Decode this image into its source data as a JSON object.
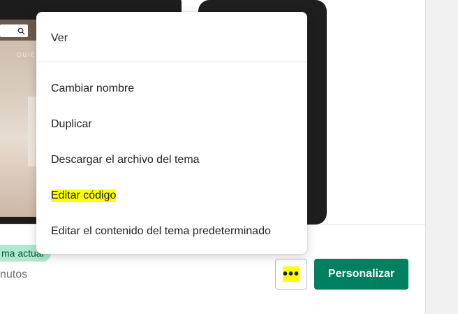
{
  "menu": {
    "items": [
      {
        "label": "Ver"
      },
      {
        "label": "Cambiar nombre"
      },
      {
        "label": "Duplicar"
      },
      {
        "label": "Descargar el archivo del tema"
      },
      {
        "label": "Editar código",
        "highlighted": true
      },
      {
        "label": "Editar el contenido del tema predeterminado"
      }
    ]
  },
  "preview": {
    "desktop_nav_text": "QUIÉN",
    "icons": {
      "search": "search-icon"
    }
  },
  "theme_card": {
    "badge_label": "ma actual",
    "meta_text": "nutos",
    "more_button_label": "•••",
    "customize_label": "Personalizar"
  },
  "colors": {
    "primary": "#008060",
    "badge_bg": "#aee9d1",
    "highlight": "#ffff00"
  }
}
